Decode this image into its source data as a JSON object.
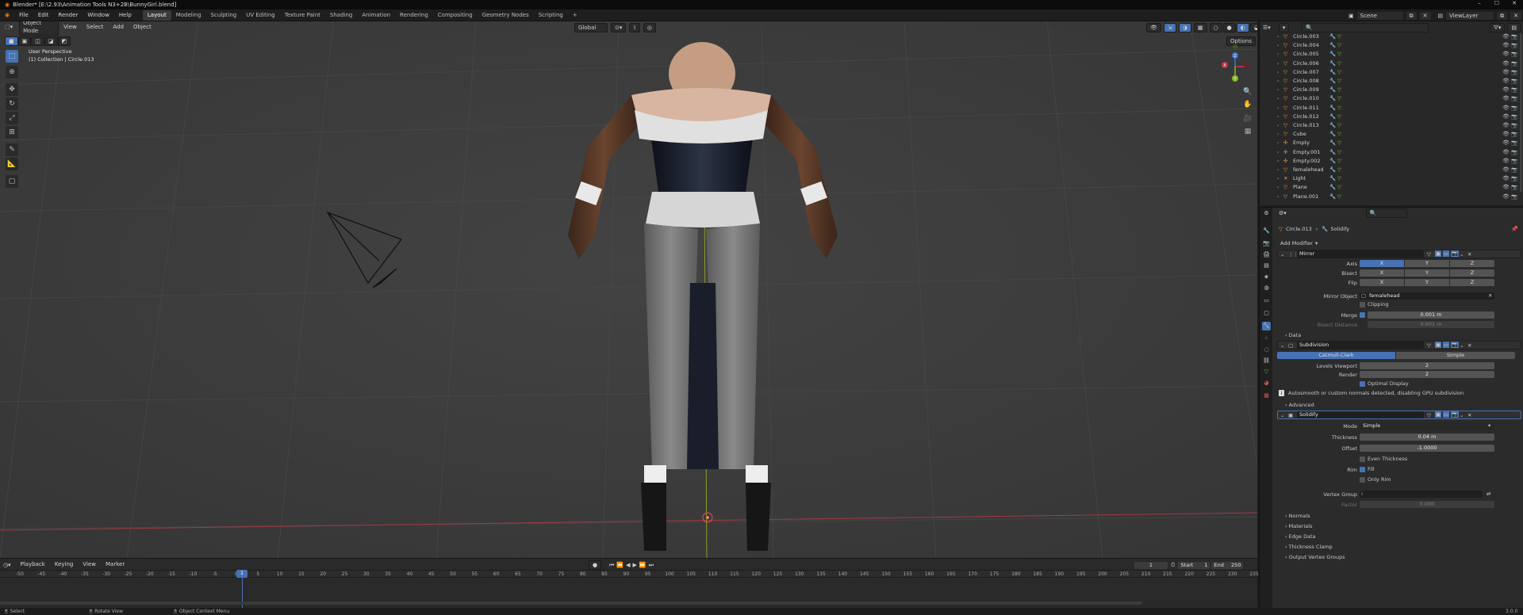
{
  "window": {
    "title": "Blender* [E:\\2.93\\Animation Tools N3+2B\\BunnyGirl.blend]"
  },
  "menu": {
    "items": [
      "File",
      "Edit",
      "Render",
      "Window",
      "Help"
    ],
    "workspaces": [
      "Layout",
      "Modeling",
      "Sculpting",
      "UV Editing",
      "Texture Paint",
      "Shading",
      "Animation",
      "Rendering",
      "Compositing",
      "Geometry Nodes",
      "Scripting",
      "+"
    ],
    "active_workspace": "Layout",
    "scene": "Scene",
    "view_layer": "ViewLayer"
  },
  "viewport": {
    "mode": "Object Mode",
    "menus": [
      "View",
      "Select",
      "Add",
      "Object"
    ],
    "orientation": "Global",
    "options": "Options",
    "overlay_line1": "User Perspective",
    "overlay_line2": "(1) Collection | Circle.013",
    "gizmo": {
      "x": "X",
      "y": "Y",
      "z": "Z"
    }
  },
  "tools": [
    "select-box",
    "cursor",
    "move",
    "rotate",
    "scale",
    "transform",
    "annotate",
    "measure",
    "add-cube"
  ],
  "timeline": {
    "menus": [
      "Playback",
      "Keying",
      "View",
      "Marker"
    ],
    "current_frame": "1",
    "start_label": "Start",
    "start": "1",
    "end_label": "End",
    "end": "250",
    "ticks": [
      "-50",
      "-45",
      "-40",
      "-35",
      "-30",
      "-25",
      "-20",
      "-15",
      "-10",
      "-5",
      "0",
      "5",
      "10",
      "15",
      "20",
      "25",
      "30",
      "35",
      "40",
      "45",
      "50",
      "55",
      "60",
      "65",
      "70",
      "75",
      "80",
      "85",
      "90",
      "95",
      "100",
      "105",
      "110",
      "115",
      "120",
      "125",
      "130",
      "135",
      "140",
      "145",
      "150",
      "155",
      "160",
      "165",
      "170",
      "175",
      "180",
      "185",
      "190",
      "195",
      "200",
      "205",
      "210",
      "215",
      "220",
      "225",
      "230",
      "235"
    ]
  },
  "statusbar": {
    "select": "Select",
    "rotate": "Rotate View",
    "context": "Object Context Menu",
    "version": "3.0.0"
  },
  "outliner": {
    "rows": [
      {
        "name": "Circle.003",
        "icon": "mesh"
      },
      {
        "name": "Circle.004",
        "icon": "mesh"
      },
      {
        "name": "Circle.005",
        "icon": "mesh"
      },
      {
        "name": "Circle.006",
        "icon": "mesh"
      },
      {
        "name": "Circle.007",
        "icon": "mesh"
      },
      {
        "name": "Circle.008",
        "icon": "mesh"
      },
      {
        "name": "Circle.009",
        "icon": "mesh"
      },
      {
        "name": "Circle.010",
        "icon": "mesh"
      },
      {
        "name": "Circle.011",
        "icon": "mesh"
      },
      {
        "name": "Circle.012",
        "icon": "mesh"
      },
      {
        "name": "Circle.013",
        "icon": "mesh"
      },
      {
        "name": "Cube",
        "icon": "mesh"
      },
      {
        "name": "Empty",
        "icon": "empty"
      },
      {
        "name": "Empty.001",
        "icon": "empty"
      },
      {
        "name": "Empty.002",
        "icon": "empty"
      },
      {
        "name": "femalehead",
        "icon": "mesh"
      },
      {
        "name": "Light",
        "icon": "light"
      },
      {
        "name": "Plane",
        "icon": "mesh"
      },
      {
        "name": "Plane.001",
        "icon": "mesh"
      }
    ]
  },
  "properties": {
    "breadcrumb_object": "Circle.013",
    "breadcrumb_modifier": "Solidify",
    "add_modifier": "Add Modifier",
    "mirror": {
      "name": "Mirror",
      "axis_label": "Axis",
      "bisect_label": "Bisect",
      "flip_label": "Flip",
      "x": "X",
      "y": "Y",
      "z": "Z",
      "mirror_object_label": "Mirror Object",
      "mirror_object": "femalehead",
      "clipping": "Clipping",
      "merge_label": "Merge",
      "merge_value": "0.001 m",
      "bisect_distance_label": "Bisect Distance",
      "bisect_distance": "0.001 m",
      "data": "Data"
    },
    "subdivision": {
      "name": "Subdivision",
      "catmull": "Catmull-Clark",
      "simple": "Simple",
      "levels_viewport_label": "Levels Viewport",
      "levels_viewport": "2",
      "render_label": "Render",
      "render": "2",
      "optimal": "Optimal Display",
      "warning": "Autosmooth or custom normals detected, disabling GPU subdivision",
      "advanced": "Advanced"
    },
    "solidify": {
      "name": "Solidify",
      "mode_label": "Mode",
      "mode": "Simple",
      "thickness_label": "Thickness",
      "thickness": "0.04 m",
      "offset_label": "Offset",
      "offset": "-1.0000",
      "even": "Even Thickness",
      "rim_label": "Rim",
      "fill": "Fill",
      "only_rim": "Only Rim",
      "vgroup_label": "Vertex Group",
      "factor_label": "Factor",
      "factor": "0.000",
      "panels": [
        "Normals",
        "Materials",
        "Edge Data",
        "Thickness Clamp",
        "Output Vertex Groups"
      ]
    }
  },
  "colors": {
    "accent": "#4772b3",
    "viewport_bg": "#3d3d3d",
    "x_axis": "#c0374a",
    "y_axis": "#88b826",
    "z_axis": "#3c78d0"
  }
}
